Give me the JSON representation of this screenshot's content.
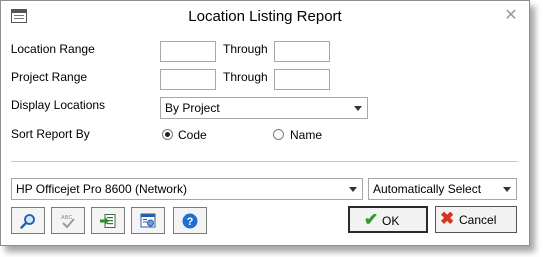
{
  "window": {
    "title": "Location Listing Report"
  },
  "fields": {
    "location_range_label": "Location Range",
    "location_from": "",
    "location_through_label": "Through",
    "location_to": "",
    "project_range_label": "Project Range",
    "project_from": "",
    "project_through_label": "Through",
    "project_to": "",
    "display_locations_label": "Display Locations",
    "display_locations_value": "By Project",
    "sort_label": "Sort Report By",
    "sort_code_label": "Code",
    "sort_name_label": "Name",
    "sort_selected": "Code"
  },
  "printer": {
    "name": "HP Officejet Pro 8600 (Network)",
    "tray": "Automatically Select"
  },
  "toolbar": {
    "icons": [
      "search-icon",
      "spellcheck-icon",
      "export-icon",
      "printer-settings-icon",
      "help-icon"
    ],
    "help_glyph": "?",
    "spell_text": "ABC"
  },
  "buttons": {
    "ok_label": "OK",
    "cancel_label": "Cancel",
    "ok_glyph": "✔",
    "cancel_glyph": "✖"
  },
  "colors": {
    "ok_check": "#2e9b2e",
    "cancel_x": "#d9321f",
    "help_blue": "#1e6fd0"
  }
}
